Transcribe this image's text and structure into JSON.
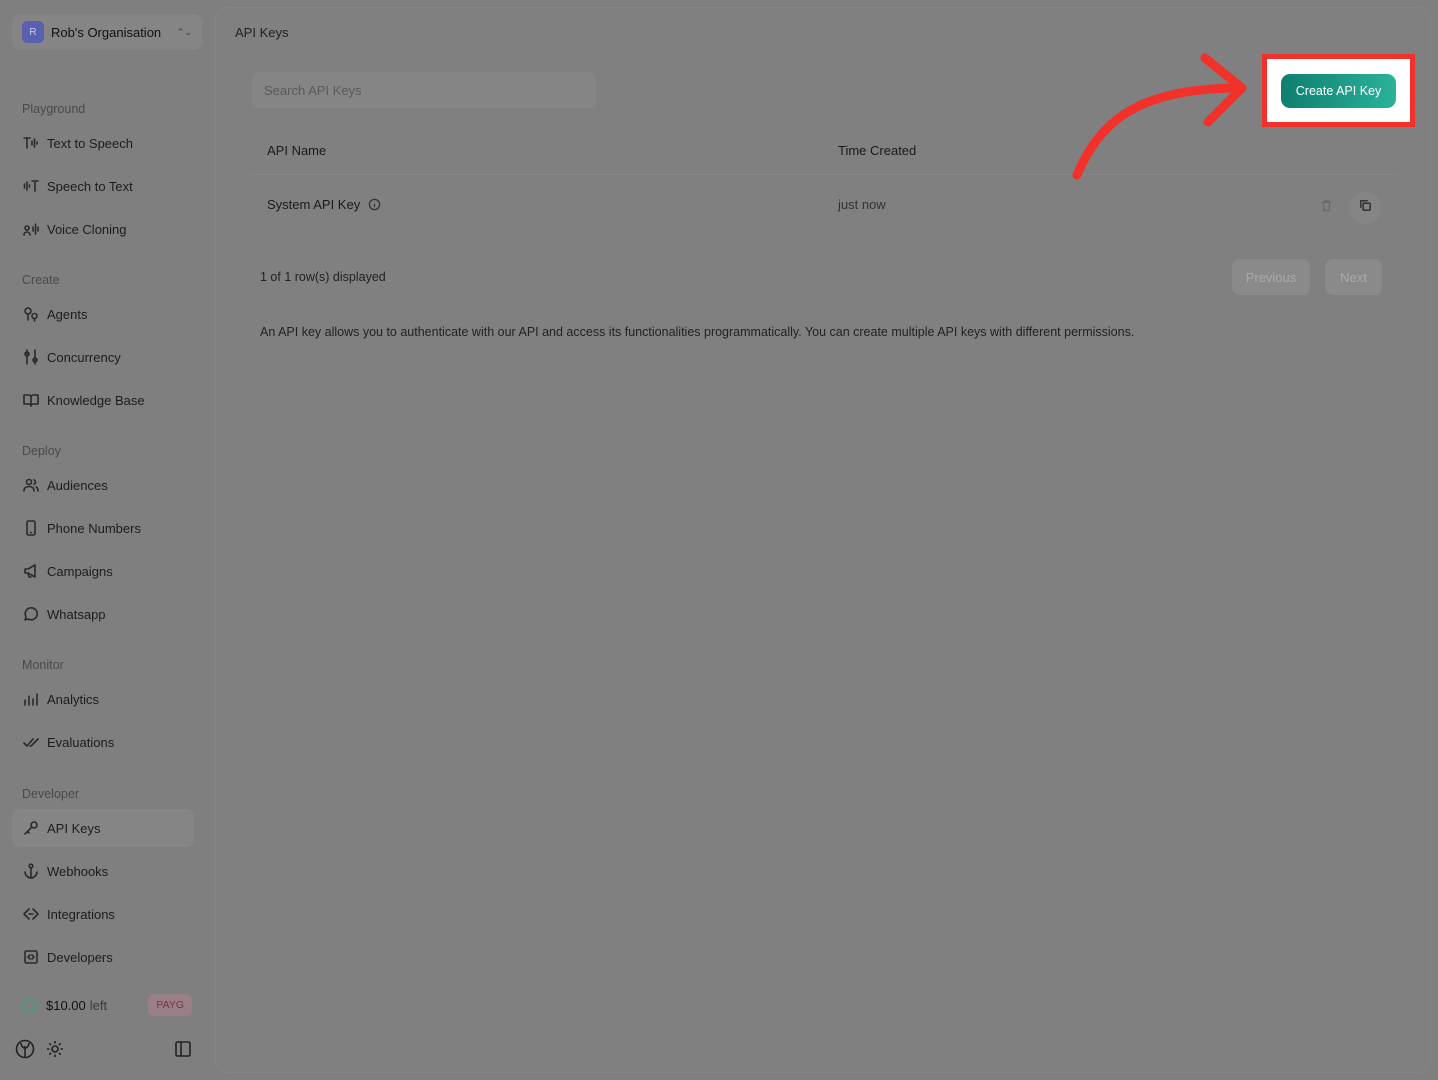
{
  "org": {
    "avatar": "R",
    "name": "Rob's Organisation"
  },
  "sidebar": {
    "sections": {
      "playground": "Playground",
      "create": "Create",
      "deploy": "Deploy",
      "monitor": "Monitor",
      "developer": "Developer"
    },
    "items": {
      "text_to_speech": "Text to Speech",
      "speech_to_text": "Speech to Text",
      "voice_cloning": "Voice Cloning",
      "agents": "Agents",
      "concurrency": "Concurrency",
      "knowledge_base": "Knowledge Base",
      "audiences": "Audiences",
      "phone_numbers": "Phone Numbers",
      "campaigns": "Campaigns",
      "whatsapp": "Whatsapp",
      "analytics": "Analytics",
      "evaluations": "Evaluations",
      "api_keys": "API Keys",
      "webhooks": "Webhooks",
      "integrations": "Integrations",
      "developers": "Developers"
    },
    "active_item": "API Keys",
    "balance": {
      "amount": "$10.00",
      "suffix": "left",
      "plan": "PAYG"
    }
  },
  "main": {
    "title": "API Keys",
    "search_placeholder": "Search API Keys",
    "create_button": "Create API Key",
    "table": {
      "columns": [
        "API Name",
        "Time Created"
      ],
      "rows": [
        {
          "name": "System API Key",
          "created": "just now"
        }
      ]
    },
    "row_count": "1 of 1 row(s) displayed",
    "pagination": {
      "previous": "Previous",
      "next": "Next"
    },
    "description": "An API key allows you to authenticate with our API and access its functionalities programmatically. You can create multiple API keys with different permissions."
  },
  "annotation": {
    "highlight_color": "#f2322a",
    "arrow_color": "#f2322a"
  },
  "colors": {
    "accent_start": "#0f7f70",
    "accent_end": "#2ab39a",
    "overlay": "#7f7f7f"
  }
}
